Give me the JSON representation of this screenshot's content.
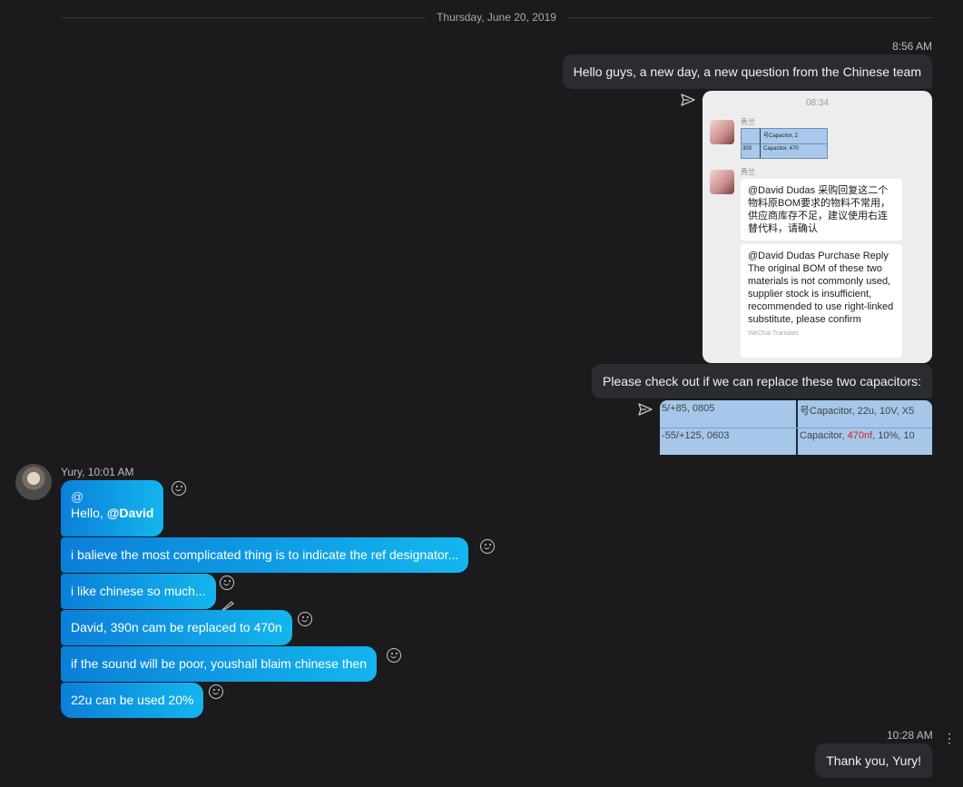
{
  "date_separator": "Thursday, June 20, 2019",
  "outgoing": {
    "time1": "8:56 AM",
    "msg1": "Hello guys, a new day, a new question from the Chinese team",
    "msg2": "Please check out if we can replace these two capacitors:",
    "time2": "10:28 AM",
    "msg3": "Thank you, Yury!"
  },
  "wechat_image": {
    "time": "08:34",
    "sender_name": "秀兰",
    "mini_row1_right": "号Capacitor, 2",
    "mini_row2_left": "303",
    "mini_row2_right": "Capacitor, 470",
    "chinese_text": "@David Dudas 采购回复这二个物料原BOM要求的物料不常用，供应商库存不足，建议使用右连替代料，请确认",
    "translation_text": "@David Dudas Purchase Reply The original BOM of these two materials is not commonly used, supplier stock is insufficient, recommended to use right-linked substitute, please confirm",
    "translation_note": "WeChat Translate"
  },
  "capacitor_image": {
    "r1_left": "5/+85, 0805",
    "r1_right": "号Capacitor, 22u, 10V, X5",
    "r2_left": "-55/+125, 0603",
    "r2_right_prefix": "Capacitor, ",
    "r2_right_red": "470nf",
    "r2_right_suffix": ", 10%, 10"
  },
  "incoming": {
    "sender": "Yury, 10:01 AM",
    "msg1_at": "@",
    "msg1_text": "Hello, ",
    "msg1_mention": "@David",
    "msg2": "i balieve the most complicated thing is to indicate the ref designator...",
    "msg3": "i like chinese so much...",
    "msg4": "David, 390n cam be replaced to 470n",
    "msg5": "if the sound will be poor, youshall blaim chinese then",
    "msg6": "22u can be used 20%"
  },
  "icons": {
    "send": "send-icon",
    "emoji": "smiley-icon",
    "more": "more-vertical-icon",
    "more_glyph": "⋮"
  },
  "colors": {
    "background": "#1b1b1e",
    "outgoing_bubble": "#2b2c31",
    "incoming_gradient_start": "#0b7fd8",
    "incoming_gradient_end": "#13b6ee"
  }
}
